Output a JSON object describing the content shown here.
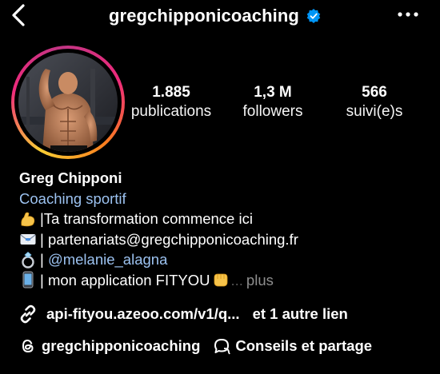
{
  "header": {
    "username": "gregchipponicoaching",
    "verified_icon": "verified-badge-icon",
    "back_icon": "chevron-left-icon",
    "more_icon": "more-horizontal-icon"
  },
  "colors": {
    "background": "#000000",
    "verified": "#0095f6",
    "link": "#9cc2f0",
    "muted": "#8e8e8e"
  },
  "stats": {
    "posts": {
      "value": "1.885",
      "label": "publications"
    },
    "followers": {
      "value": "1,3 M",
      "label": "followers"
    },
    "following": {
      "value": "566",
      "label": "suivi(e)s"
    }
  },
  "bio": {
    "name": "Greg Chipponi",
    "category": "Coaching sportif",
    "lines": [
      {
        "icon": "flexed-biceps-emoji",
        "text": "|Ta transformation commence ici"
      },
      {
        "icon": "envelope-emoji",
        "text": "| partenariats@gregchipponicoaching.fr"
      },
      {
        "icon": "ring-emoji",
        "prefix": "| ",
        "mention": "@melanie_alagna"
      },
      {
        "icon": "mobile-phone-emoji",
        "text": "| mon application FITYOU",
        "trailing_icon": "oncoming-fist-emoji",
        "ellipsis": "...",
        "more": "plus"
      }
    ]
  },
  "link": {
    "icon": "link-icon",
    "url": "api-fityou.azeoo.com/v1/q...",
    "extra": "et 1 autre lien"
  },
  "chips": [
    {
      "icon": "threads-icon",
      "label": "gregchipponicoaching"
    },
    {
      "icon": "speech-bubble-icon",
      "label": "Conseils et partage"
    }
  ]
}
